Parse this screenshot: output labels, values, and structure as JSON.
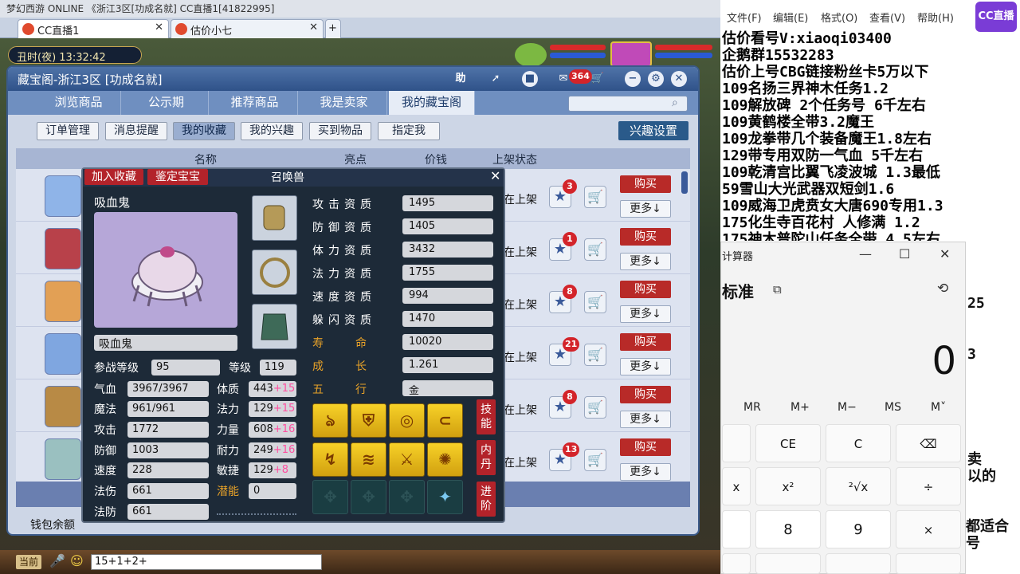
{
  "browser": {
    "topbar_text": "梦幻西游 ONLINE    《浙江3区[功成名就]    CC直播1[41822995]",
    "tabs": [
      {
        "label": "CC直播1"
      },
      {
        "label": "估价小七"
      }
    ]
  },
  "game": {
    "clock": "丑时(夜)  13:32:42",
    "chat_input": "15+1+2+",
    "current_label": "当前"
  },
  "cbg": {
    "title": "藏宝阁-浙江3区 [功成名就]",
    "header_buttons": [
      "助"
    ],
    "cart_badge": "364",
    "nav_tabs": [
      "浏览商品",
      "公示期",
      "推荐商品",
      "我是卖家",
      "我的藏宝阁"
    ],
    "sub_tabs": [
      "订单管理",
      "消息提醒",
      "我的收藏",
      "我的兴趣",
      "买到物品",
      "指定我"
    ],
    "interest_button": "兴趣设置",
    "columns": {
      "name": "名称",
      "highlight": "亮点",
      "price": "价钱",
      "status": "上架状态"
    },
    "rows": [
      {
        "status": "在上架",
        "fav_count": "3",
        "buy": "购买",
        "more": "更多↓"
      },
      {
        "status": "在上架",
        "fav_count": "1",
        "buy": "购买",
        "more": "更多↓"
      },
      {
        "status": "在上架",
        "fav_count": "8",
        "buy": "购买",
        "more": "更多↓"
      },
      {
        "status": "在上架",
        "fav_count": "21",
        "buy": "购买",
        "more": "更多↓"
      },
      {
        "status": "在上架",
        "fav_count": "8",
        "buy": "购买",
        "more": "更多↓"
      },
      {
        "status": "在上架",
        "fav_count": "13",
        "buy": "购买",
        "more": "更多↓"
      }
    ],
    "balance_label": "钱包余额"
  },
  "pet": {
    "btn_add_fav": "加入收藏",
    "btn_appraise": "鉴定宝宝",
    "title": "召唤兽",
    "name": "吸血鬼",
    "name_field": "吸血鬼",
    "battle_level_label": "参战等级",
    "battle_level": "95",
    "level_label": "等级",
    "level": "119",
    "stats_left": [
      {
        "label": "气血",
        "value": "3967/3967"
      },
      {
        "label": "魔法",
        "value": "961/961"
      },
      {
        "label": "攻击",
        "value": "1772"
      },
      {
        "label": "防御",
        "value": "1003"
      },
      {
        "label": "速度",
        "value": "228"
      },
      {
        "label": "法伤",
        "value": "661"
      },
      {
        "label": "法防",
        "value": "661"
      }
    ],
    "stats_right": [
      {
        "label": "体质",
        "value": "443",
        "plus": "+15"
      },
      {
        "label": "法力",
        "value": "129",
        "plus": "+15"
      },
      {
        "label": "力量",
        "value": "608",
        "plus": "+16"
      },
      {
        "label": "耐力",
        "value": "249",
        "plus": "+16"
      },
      {
        "label": "敏捷",
        "value": "129",
        "plus": "+8"
      },
      {
        "label": "潜能",
        "value": "0",
        "plus": ""
      }
    ],
    "aptitudes": [
      {
        "label": "攻击资质",
        "value": "1495"
      },
      {
        "label": "防御资质",
        "value": "1405"
      },
      {
        "label": "体力资质",
        "value": "3432"
      },
      {
        "label": "法力资质",
        "value": "1755"
      },
      {
        "label": "速度资质",
        "value": "994"
      },
      {
        "label": "躲闪资质",
        "value": "1470"
      },
      {
        "label": "寿命",
        "value": "10020"
      },
      {
        "label": "成长",
        "value": "1.261"
      },
      {
        "label": "五行",
        "value": "金"
      }
    ],
    "side_buttons": [
      "技能",
      "内丹",
      "进阶"
    ]
  },
  "notepad": {
    "menu": [
      "文件(F)",
      "编辑(E)",
      "格式(O)",
      "查看(V)",
      "帮助(H)"
    ],
    "lines": [
      "估价看号V:xiaoqi03400",
      "企鹅群15532283",
      "估价上号CBG链接",
      "109名扬三界神木任务1.2",
      "109解放碑 2个任务号 6千左右",
      "109黄鹤楼全带3.2魔王",
      "109龙拳带几个装备魔王1.8左右",
      "129带专用双防一气血 5千左右",
      "109乾清宫比翼飞凌波城 1.3最低",
      "59雪山大光武器双短剑1.6",
      "109威海卫虎贲女大唐690专用1.3",
      "175化生寺百花村 人修满 1.2",
      "175神木普陀山任务全带 4.5左右"
    ],
    "line3_tail": "粉丝卡5万以下",
    "right_fragments": [
      "25",
      "3",
      "卖",
      "以的",
      "都适合",
      "号"
    ],
    "logo": "CC直播"
  },
  "calculator": {
    "title": "计算器",
    "mode": "标准",
    "display": "0",
    "memory_keys": [
      "MR",
      "M+",
      "M−",
      "MS",
      "M˅"
    ],
    "row1": [
      "",
      "CE",
      "C",
      "⌫"
    ],
    "row2": [
      "x",
      "x²",
      "²√x",
      "÷"
    ],
    "row3": [
      "",
      "8",
      "9",
      "×"
    ]
  }
}
